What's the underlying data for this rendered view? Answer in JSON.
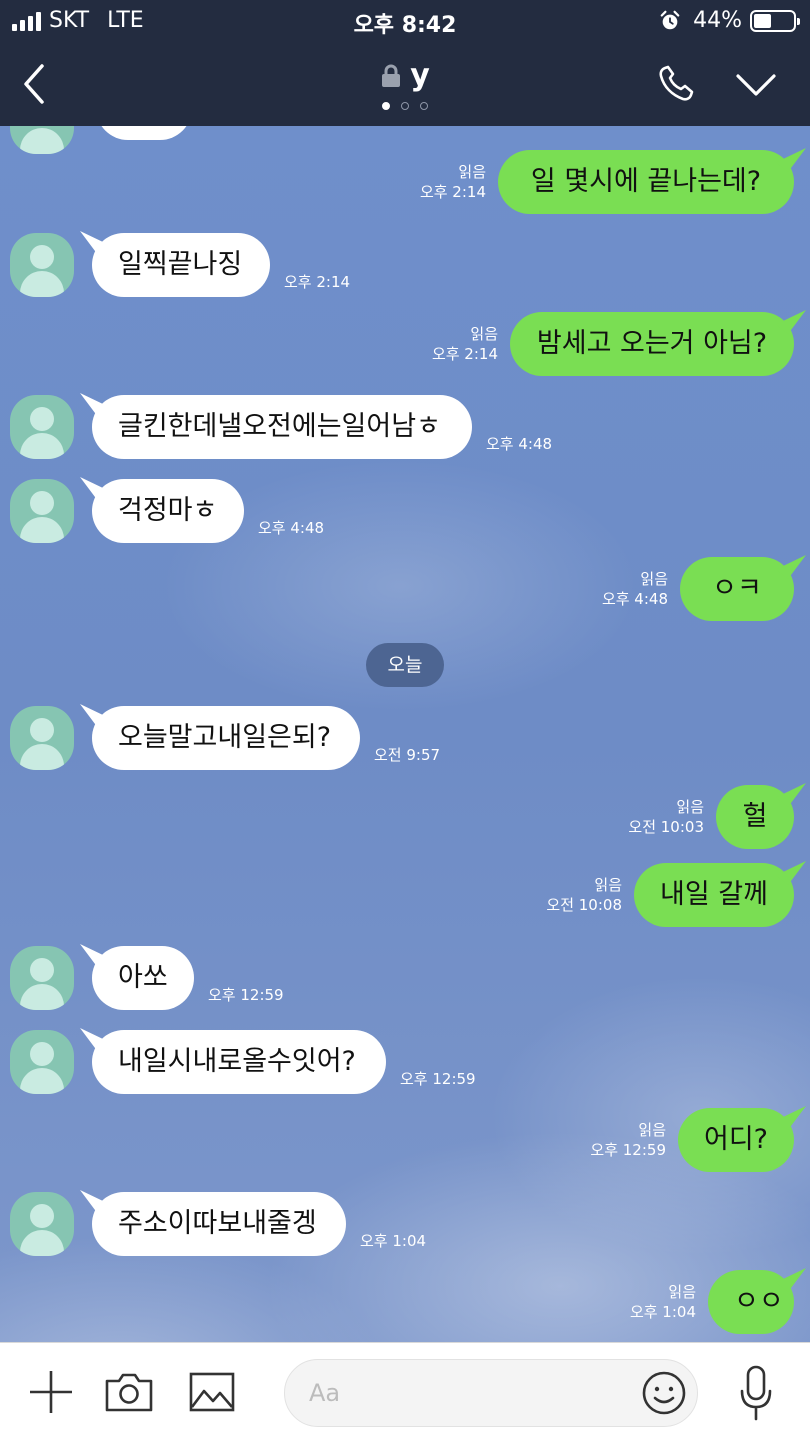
{
  "status_bar": {
    "carrier": "SKT",
    "network": "LTE",
    "time": "오후 8:42",
    "battery_percent": "44%",
    "battery_level": 0.44
  },
  "header": {
    "title": "y",
    "page_indicator_count": 3,
    "page_indicator_active": 0
  },
  "messages": [
    {
      "side": "out",
      "text": "일 몇시에 끝나는데?",
      "read": "읽음",
      "time": "오후 2:14"
    },
    {
      "side": "in",
      "text": "일찍끝나징",
      "time": "오후 2:14"
    },
    {
      "side": "out",
      "text": "밤세고 오는거 아님?",
      "read": "읽음",
      "time": "오후 2:14"
    },
    {
      "side": "in",
      "text": "글킨한데낼오전에는일어남ㅎ",
      "time": "오후 4:48"
    },
    {
      "side": "in",
      "text": "걱정마ㅎ",
      "time": "오후 4:48"
    },
    {
      "side": "out",
      "text": "ㅇㅋ",
      "read": "읽음",
      "time": "오후 4:48"
    },
    {
      "type": "date",
      "text": "오늘"
    },
    {
      "side": "in",
      "text": "오늘말고내일은되?",
      "time": "오전 9:57"
    },
    {
      "side": "out",
      "text": "헐",
      "read": "읽음",
      "time": "오전 10:03"
    },
    {
      "side": "out",
      "text": "내일 갈께",
      "read": "읽음",
      "time": "오전 10:08"
    },
    {
      "side": "in",
      "text": "아쏘",
      "time": "오후 12:59"
    },
    {
      "side": "in",
      "text": "내일시내로올수잇어?",
      "time": "오후 12:59"
    },
    {
      "side": "out",
      "text": "어디?",
      "read": "읽음",
      "time": "오후 12:59"
    },
    {
      "side": "in",
      "text": "주소이따보내줄겡",
      "time": "오후 1:04"
    },
    {
      "side": "out",
      "text": "ㅇㅇ",
      "read": "읽음",
      "time": "오후 1:04"
    }
  ],
  "input_bar": {
    "placeholder": "Aa"
  },
  "icons": {
    "back": "chevron-left-icon",
    "lock": "lock-icon",
    "call": "phone-icon",
    "menu": "chevron-down-icon",
    "add": "plus-icon",
    "camera": "camera-icon",
    "gallery": "image-icon",
    "emoji": "smiley-icon",
    "voice": "microphone-icon"
  },
  "colors": {
    "header_bg": "#232c40",
    "outgoing_bubble": "#7ade53",
    "incoming_bubble": "#ffffff",
    "chat_bg": "#6e8cc6"
  }
}
